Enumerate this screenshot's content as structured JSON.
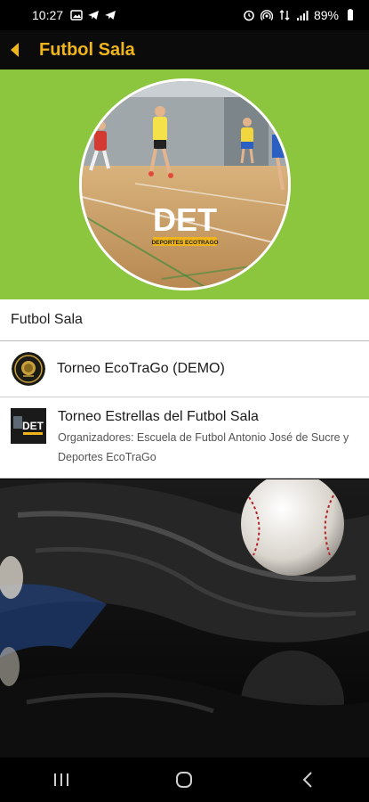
{
  "status_bar": {
    "time": "10:27",
    "battery": "89%",
    "left_icons": [
      "image-icon",
      "telegram-icon",
      "telegram-icon"
    ],
    "right_icons": [
      "alarm-icon",
      "hotspot-icon",
      "data-icon",
      "signal-icon",
      "battery-icon"
    ]
  },
  "app_bar": {
    "title": "Futbol Sala",
    "back_icon": "chevron-left-icon",
    "accent_color": "#f1b51c"
  },
  "hero": {
    "background_color": "#8cc63f",
    "logo_text": "DET",
    "logo_subtext": "DEPORTES ECOTRAGO"
  },
  "list": {
    "header": "Futbol Sala",
    "items": [
      {
        "title": "Torneo EcoTraGo (DEMO)",
        "subtitle": "",
        "avatar_icon": "lion-crest-icon"
      },
      {
        "title": "Torneo Estrellas del Futbol Sala",
        "subtitle": "Organizadores: Escuela de Futbol Antonio José de Sucre y Deportes EcoTraGo",
        "avatar_icon": "det-logo-icon"
      }
    ]
  },
  "nav_bar": {
    "buttons": [
      "recents-icon",
      "home-icon",
      "back-icon"
    ]
  }
}
